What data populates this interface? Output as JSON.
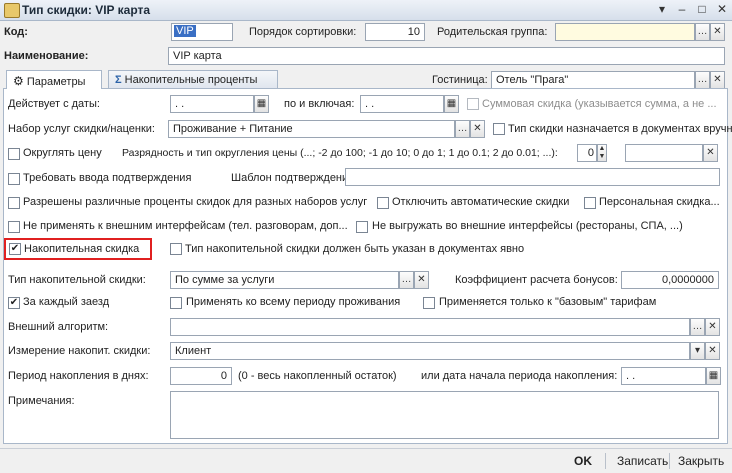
{
  "window": {
    "title": "Тип скидки: VIP карта",
    "controls": {
      "menu": "▾",
      "minimize": "–",
      "maximize": "□",
      "close": "✕"
    }
  },
  "header": {
    "code_label": "Код:",
    "code_value": "VIP",
    "sort_label": "Порядок сортировки:",
    "sort_value": "10",
    "parent_label": "Родительская группа:",
    "parent_value": "",
    "name_label": "Наименование:",
    "name_value": "VIP карта"
  },
  "tabs": [
    {
      "label": "Параметры",
      "icon": "gear-icon"
    },
    {
      "label": "Накопительные проценты",
      "icon": "sigma-icon"
    }
  ],
  "hotel": {
    "label": "Гостиница:",
    "value": "Отель \"Прага\""
  },
  "params": {
    "from_label": "Действует с даты:",
    "from_value": " .  .",
    "to_label": "по и включая:",
    "to_value": " .  .",
    "sum_discount_label": "Суммовая скидка (указывается сумма, а не ...",
    "services_label": "Набор услуг скидки/наценки:",
    "services_value": "Проживание + Питание",
    "type_in_docs_label": "Тип скидки назначается в документах вручную",
    "round_price_label": "Округлять цену",
    "rounding_label": "Разрядность и тип округления цены (...; -2 до 100; -1 до 10; 0 до 1; 1 до 0.1; 2 до 0.01; ...):",
    "rounding_value": "0",
    "require_confirm_label": "Требовать ввода подтверждения",
    "confirm_template_label": "Шаблон подтверждения:",
    "diff_percents_label": "Разрешены различные проценты скидок для разных наборов услуг",
    "disable_auto_label": "Отключить автоматические скидки",
    "personal_label": "Персональная скидка...",
    "no_external_label": "Не применять к внешним интерфейсам (тел. разговорам, доп...",
    "no_unload_label": "Не выгружать во внешние интерфейсы (рестораны, СПА, ...)",
    "cumulative_label": "Накопительная скидка",
    "cumulative_checked": true,
    "cumulative_type_in_docs_label": "Тип накопительной скидки должен быть указан в документах явно",
    "cum_type_label": "Тип накопительной скидки:",
    "cum_type_value": "По сумме за услуги",
    "bonus_coef_label": "Коэффициент расчета бонусов:",
    "bonus_coef_value": "0,0000000",
    "each_stay_label": "За каждый заезд",
    "each_stay_checked": true,
    "whole_period_label": "Применять ко всему периоду проживания",
    "base_rates_label": "Применяется только к \"базовым\" тарифам",
    "ext_algo_label": "Внешний алгоритм:",
    "ext_algo_value": "",
    "dimension_label": "Измерение накопит. скидки:",
    "dimension_value": "Клиент",
    "period_days_label": "Период накопления в днях:",
    "period_days_value": "0",
    "period_note": "(0 - весь накопленный остаток)",
    "period_start_label": "или дата начала периода накопления:",
    "period_start_value": " .  .",
    "notes_label": "Примечания:",
    "notes_value": ""
  },
  "footer": {
    "ok": "OK",
    "save": "Записать",
    "close": "Закрыть"
  }
}
